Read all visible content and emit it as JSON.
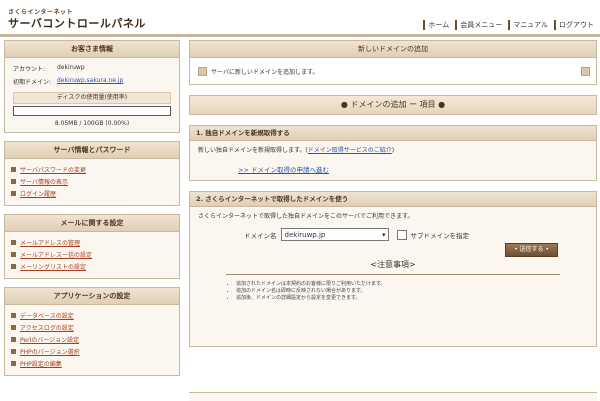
{
  "header": {
    "brand_sub": "さくらインターネット",
    "brand_main": "サーバコントロールパネル",
    "nav": [
      "ホーム",
      "会員メニュー",
      "マニュアル",
      "ログアウト"
    ]
  },
  "sidebar": {
    "customer": {
      "title": "お客さま情報",
      "account_label": "アカウント:",
      "account_value": "dekiruwp",
      "domain_label": "初期ドメイン:",
      "domain_value": "dekiruwp.sakura.ne.jp",
      "disk_label": "ディスクの使用量(使用率)",
      "disk_value": "8.05MB / 100GB (0.00%)",
      "disk_percent": 0
    },
    "server_info": {
      "title": "サーバ情報とパスワード",
      "items": [
        "サーバパスワードの変更",
        "サーバ情報の表示",
        "ログイン履歴"
      ]
    },
    "mail": {
      "title": "メールに関する設定",
      "items": [
        "メールアドレスの管理",
        "メールアドレス一括の設定",
        "メーリングリストの設定"
      ]
    },
    "app": {
      "title": "アプリケーションの設定",
      "items": [
        "データベースの設定",
        "アクセスログの設定",
        "Perlのバージョン設定",
        "PHPのバージョン選択",
        "PHP設定の編集"
      ]
    }
  },
  "main": {
    "panel_title": "新しいドメインの追加",
    "notice": "サーバに新しいドメインを追加します。",
    "section_heading": "● ドメインの追加 ー 項目 ●",
    "card1": {
      "title": "1. 独自ドメインを新規取得する",
      "desc_prefix": "新しい独自ドメインを新規取得します。(",
      "desc_link": "ドメイン取得サービスのご紹介",
      "desc_suffix": ")",
      "guide_link": ">> ドメイン取得の申請へ進む"
    },
    "card2": {
      "title": "2. さくらインターネットで取得したドメインを使う",
      "desc": "さくらインターネットで取得した独自ドメインをこのサーバでご利用できます。",
      "domain_label": "ドメイン名",
      "domain_selected": "dekiruwp.jp",
      "subdomain_label": "サブドメインを指定",
      "add_button": "• 送信する •",
      "notes_title": "<注意事項>",
      "notes": [
        "追加されたドメインは本契約のお客様に限りご利用いただけます。",
        "追加のドメイン名は即時に反映されない場合があります。",
        "追加後、ドメインの詳細設定から設定を変更できます。"
      ]
    }
  }
}
